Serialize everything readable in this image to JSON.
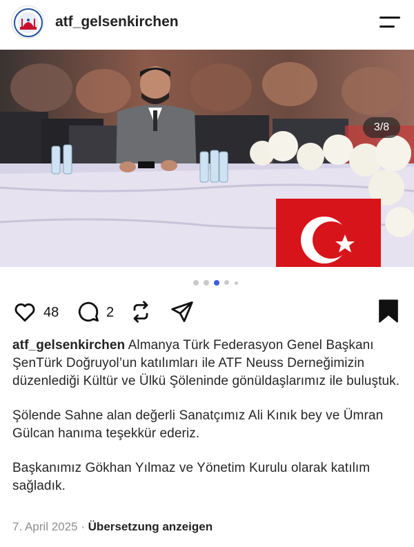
{
  "post": {
    "username": "atf_gelsenkirchen",
    "image_counter": "3/8",
    "likes": "48",
    "comments": "2",
    "caption_paragraphs": [
      "Almanya Türk Federasyon Genel Başkanı ŞenTürk Doğruyol’un katılımları ile ATF Neuss Derneğimizin düzenlediği Kültür ve Ülkü Şöleninde gönüldaşlarımız ile buluştuk.",
      "Şölende Sahne alan değerli Sanatçımız Ali Kınık bey ve Ümran Gülcan hanıma teşekkür ederiz.",
      "Başkanımız Gökhan Yılmaz ve Yönetim Kurulu olarak katılım sağladık."
    ],
    "date": "7. April 2025",
    "separator": "·",
    "translate_label": "Übersetzung anzeigen"
  },
  "icons": {
    "menu": "hamburger-menu-icon",
    "like": "heart-icon",
    "comment": "comment-bubble-icon",
    "repost": "repost-icon",
    "share": "send-icon",
    "save": "bookmark-filled-icon"
  },
  "colors": {
    "accent_dot": "#3b5bdb",
    "flag_red": "#d7141a",
    "text_secondary": "#8e8e8e"
  }
}
